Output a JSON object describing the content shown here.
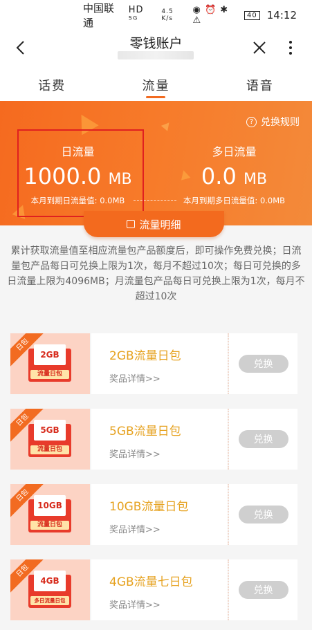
{
  "status": {
    "carrier": "中国联通",
    "net": "HD ⁵ᴳ",
    "speed": "4.5 K/s",
    "icons": "◉ ⏰ ✱ ⚠",
    "battery": "40",
    "time": "14:12"
  },
  "nav": {
    "title": "零钱账户"
  },
  "tabs": [
    {
      "label": "话费"
    },
    {
      "label": "流量"
    },
    {
      "label": "语音"
    }
  ],
  "banner": {
    "rules_label": "兑换规则",
    "daily": {
      "label": "日流量",
      "value": "1000.0",
      "unit": "MB",
      "foot": "本月到期日流量值: 0.0MB"
    },
    "multi": {
      "label": "多日流量",
      "value": "0.0",
      "unit": "MB",
      "foot": "本月到期多日流量值: 0.0MB"
    },
    "detail_label": "流量明细"
  },
  "description": "累计获取流量值至相应流量包产品额度后，即可操作免费兑换；日流量包产品每日可兑换上限为1次，每月不超过10次；每日可兑换的多日流量上限为4096MB；月流量包产品每日可兑换上限为1次，每月不超过10次",
  "products": [
    {
      "tag": "日包",
      "icon_text": "2GB",
      "icon_caption": "流量日包",
      "name": "2GB流量日包",
      "detail": "奖品详情>>",
      "button": "兑换"
    },
    {
      "tag": "日包",
      "icon_text": "5GB",
      "icon_caption": "流量日包",
      "name": "5GB流量日包",
      "detail": "奖品详情>>",
      "button": "兑换"
    },
    {
      "tag": "日包",
      "icon_text": "10GB",
      "icon_caption": "流量日包",
      "name": "10GB流量日包",
      "detail": "奖品详情>>",
      "button": "兑换"
    },
    {
      "tag": "日包",
      "icon_text": "4GB",
      "icon_caption": "多日流量日包",
      "name": "4GB流量七日包",
      "detail": "奖品详情>>",
      "button": "兑换"
    }
  ],
  "colors": {
    "accent": "#f26b21",
    "gold": "#e6a220",
    "button_disabled": "#cfcfcf"
  }
}
